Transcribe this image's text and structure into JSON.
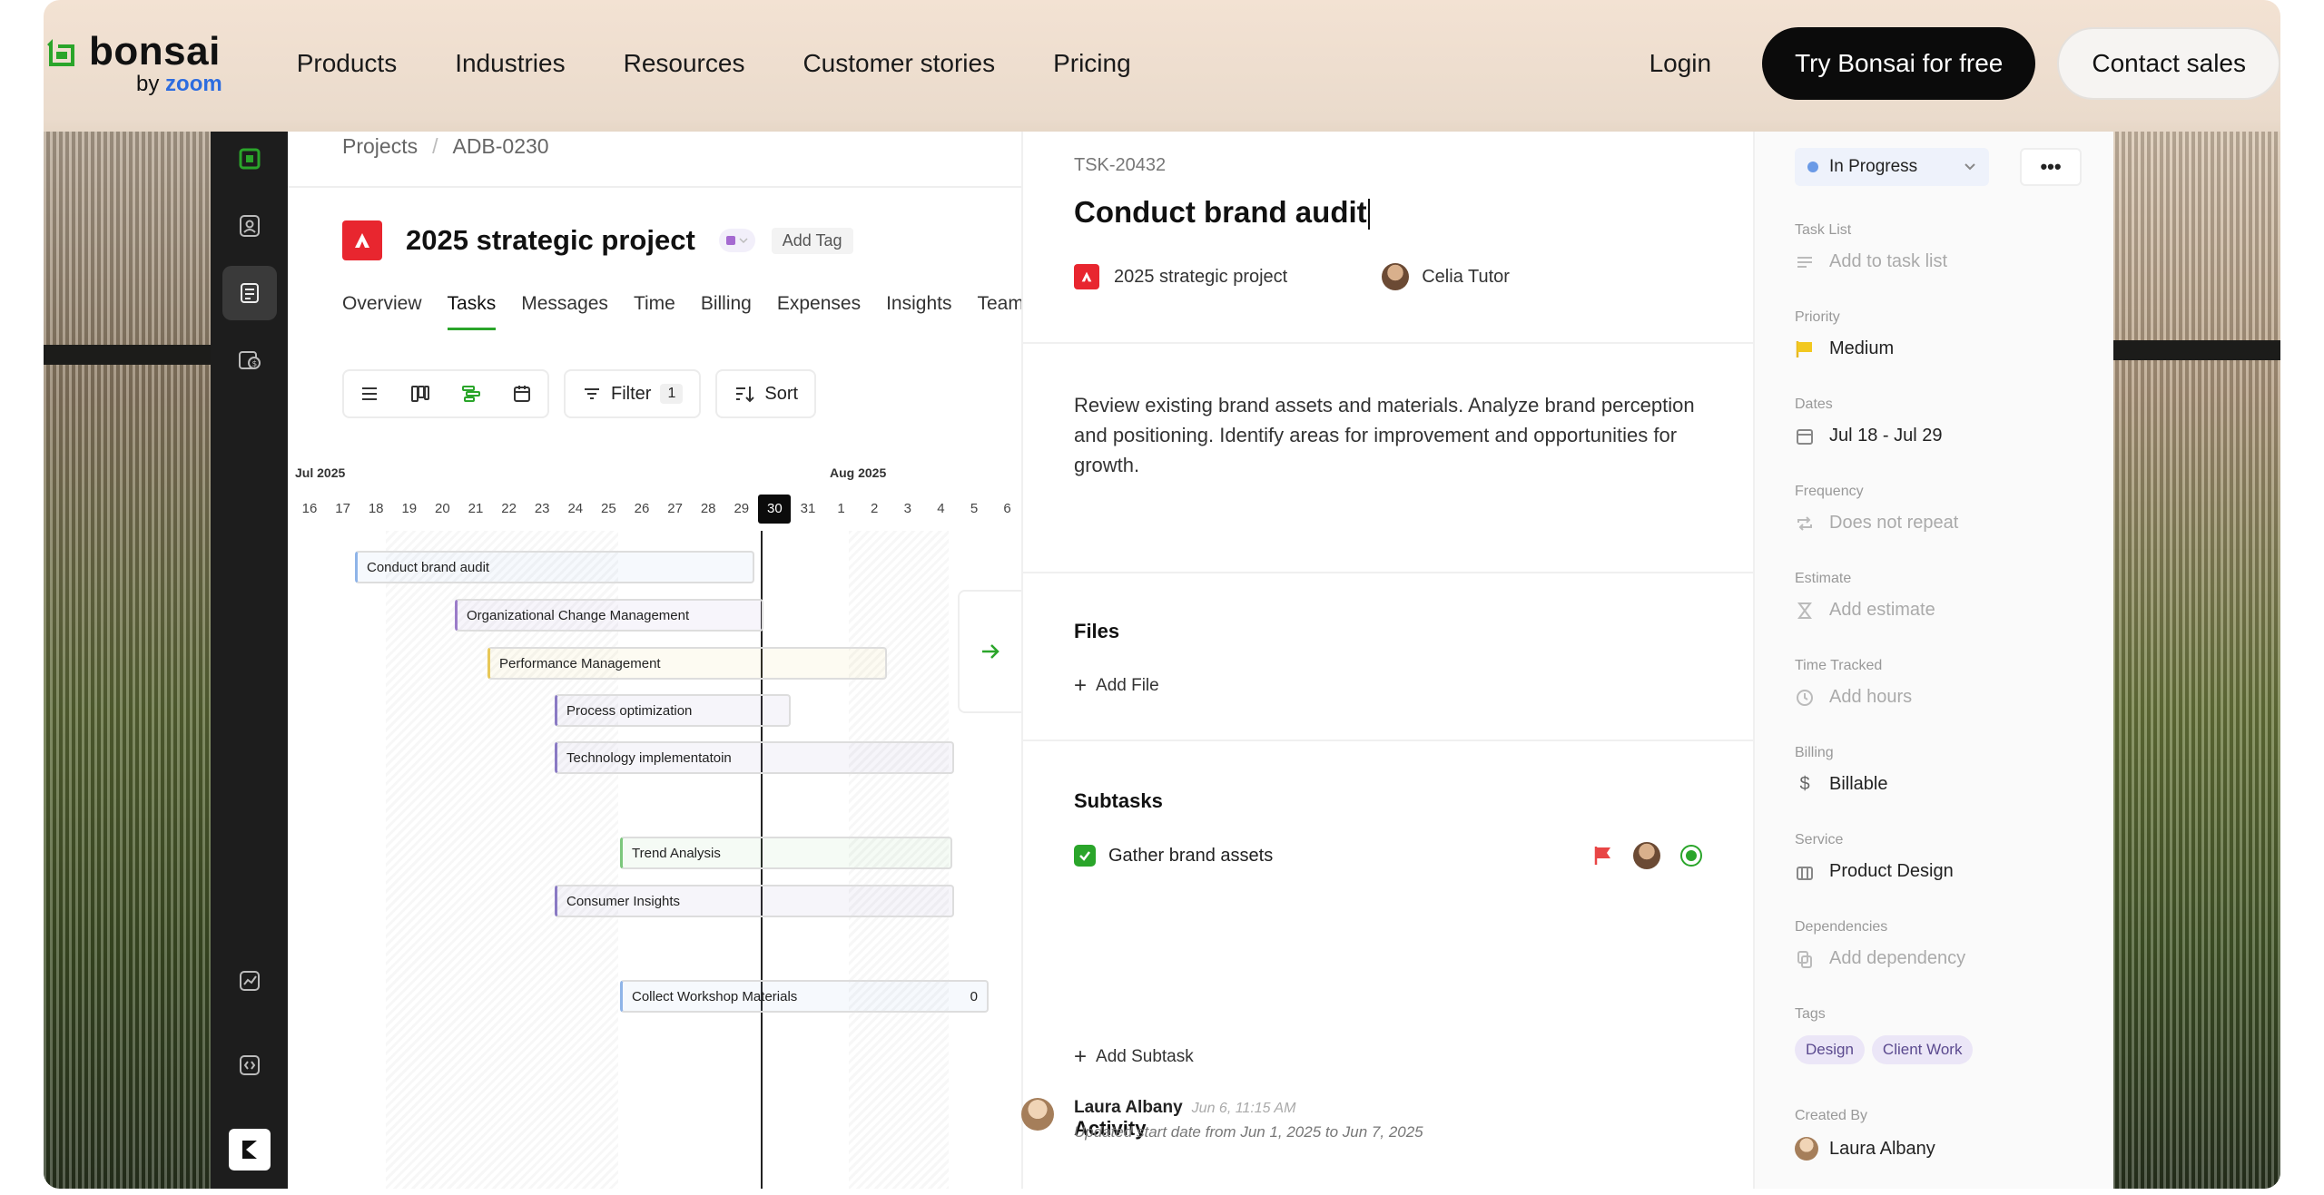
{
  "nav": {
    "logo_word": "bonsai",
    "logo_sub_prefix": "by",
    "logo_sub_brand": "zoom",
    "links": [
      "Products",
      "Industries",
      "Resources",
      "Customer stories",
      "Pricing"
    ],
    "login": "Login",
    "cta_primary": "Try Bonsai for free",
    "cta_secondary": "Contact sales"
  },
  "project": {
    "breadcrumb": [
      "Projects",
      "ADB-0230"
    ],
    "title": "2025 strategic project",
    "add_tag": "Add Tag",
    "tabs": [
      "Overview",
      "Tasks",
      "Messages",
      "Time",
      "Billing",
      "Expenses",
      "Insights",
      "Team"
    ],
    "active_tab": "Tasks",
    "filter_label": "Filter",
    "filter_count": "1",
    "sort_label": "Sort"
  },
  "gantt": {
    "months": [
      "Jul 2025",
      "Aug 2025"
    ],
    "days": [
      "16",
      "17",
      "18",
      "19",
      "20",
      "21",
      "22",
      "23",
      "24",
      "25",
      "26",
      "27",
      "28",
      "29",
      "30",
      "31",
      "1",
      "2",
      "3",
      "4",
      "5",
      "6"
    ],
    "today": "30",
    "bars": [
      {
        "label": "Conduct brand audit",
        "color": "#8fb4e8"
      },
      {
        "label": "Organizational Change Management",
        "color": "#9b7cc9"
      },
      {
        "label": "Performance Management",
        "color": "#e8c858"
      },
      {
        "label": "Process optimization",
        "color": "#8a7ac4"
      },
      {
        "label": "Technology implementatoin",
        "color": "#8a7ac4"
      },
      {
        "label": "Trend Analysis",
        "color": "#7cc77c"
      },
      {
        "label": "Consumer Insights",
        "color": "#8a7ac4"
      },
      {
        "label": "Collect Workshop Materials",
        "color": "#8fb4e8",
        "count": "0"
      }
    ]
  },
  "task": {
    "id": "TSK-20432",
    "title": "Conduct brand audit",
    "project": "2025 strategic project",
    "assignee": "Celia Tutor",
    "description": "Review existing brand assets and materials. Analyze brand perception and positioning. Identify areas for improvement and opportunities for growth.",
    "files_title": "Files",
    "add_file": "Add File",
    "subtasks_title": "Subtasks",
    "subtask": "Gather brand assets",
    "add_subtask": "Add Subtask",
    "activity_title": "Activity",
    "activity": {
      "name": "Laura Albany",
      "time": "Jun 6, 11:15 AM",
      "text": "Updated start date from Jun 1, 2025 to Jun 7, 2025"
    }
  },
  "props": {
    "status": "In Progress",
    "task_list_label": "Task List",
    "task_list_value": "Add to task list",
    "priority_label": "Priority",
    "priority_value": "Medium",
    "dates_label": "Dates",
    "dates_value": "Jul 18 - Jul 29",
    "frequency_label": "Frequency",
    "frequency_value": "Does not repeat",
    "estimate_label": "Estimate",
    "estimate_value": "Add estimate",
    "time_label": "Time Tracked",
    "time_value": "Add hours",
    "billing_label": "Billing",
    "billing_value": "Billable",
    "service_label": "Service",
    "service_value": "Product Design",
    "dependencies_label": "Dependencies",
    "dependencies_value": "Add dependency",
    "tags_label": "Tags",
    "tags": [
      "Design",
      "Client Work"
    ],
    "created_label": "Created By",
    "created_value": "Laura Albany"
  },
  "colors": {
    "accent_green": "#2aa52a",
    "brand_red": "#e8262f",
    "primary_button": "#0b0b0b",
    "status_blue": "#6a9ae6"
  }
}
